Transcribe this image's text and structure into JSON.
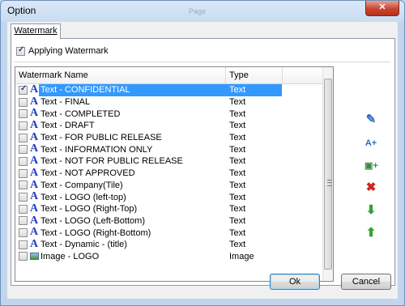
{
  "window": {
    "title": "Option",
    "ghost_title": "Page",
    "close_glyph": "✕"
  },
  "tabs": [
    {
      "label": "Watermark"
    }
  ],
  "apply": {
    "label": "Applying Watermark",
    "checked": true
  },
  "list": {
    "columns": [
      "Watermark Name",
      "Type"
    ],
    "rows": [
      {
        "name": "Text - CONFIDENTIAL",
        "type": "Text",
        "checked": true,
        "selected": true,
        "icon": "text-a-icon"
      },
      {
        "name": "Text - FINAL",
        "type": "Text",
        "checked": false,
        "icon": "text-a-icon"
      },
      {
        "name": "Text - COMPLETED",
        "type": "Text",
        "checked": false,
        "icon": "text-a-icon"
      },
      {
        "name": "Text - DRAFT",
        "type": "Text",
        "checked": false,
        "icon": "text-a-icon"
      },
      {
        "name": "Text - FOR PUBLIC RELEASE",
        "type": "Text",
        "checked": false,
        "icon": "text-a-icon"
      },
      {
        "name": "Text - INFORMATION ONLY",
        "type": "Text",
        "checked": false,
        "icon": "text-a-icon"
      },
      {
        "name": "Text - NOT FOR PUBLIC RELEASE",
        "type": "Text",
        "checked": false,
        "icon": "text-a-icon"
      },
      {
        "name": "Text - NOT APPROVED",
        "type": "Text",
        "checked": false,
        "icon": "text-a-icon"
      },
      {
        "name": "Text - Company(Tile)",
        "type": "Text",
        "checked": false,
        "icon": "text-a-icon"
      },
      {
        "name": "Text - LOGO (left-top)",
        "type": "Text",
        "checked": false,
        "icon": "text-a-icon"
      },
      {
        "name": "Text - LOGO (Right-Top)",
        "type": "Text",
        "checked": false,
        "icon": "text-a-icon"
      },
      {
        "name": "Text - LOGO (Left-Bottom)",
        "type": "Text",
        "checked": false,
        "icon": "text-a-icon"
      },
      {
        "name": "Text - LOGO (Right-Bottom)",
        "type": "Text",
        "checked": false,
        "icon": "text-a-icon"
      },
      {
        "name": "Text - Dynamic - (title)",
        "type": "Text",
        "checked": false,
        "icon": "text-a-icon"
      },
      {
        "name": "Image - LOGO",
        "type": "Image",
        "checked": false,
        "icon": "image-icon"
      }
    ]
  },
  "side_actions": [
    {
      "name": "edit-watermark-button",
      "icon": "edit-icon",
      "glyph": "✎",
      "color": "#2f6fc4"
    },
    {
      "name": "add-text-watermark-button",
      "icon": "add-text-icon",
      "glyph": "A+",
      "color": "#2f6fc4"
    },
    {
      "name": "add-image-watermark-button",
      "icon": "add-image-icon",
      "glyph": "▣+",
      "color": "#3a8a3a"
    },
    {
      "name": "delete-watermark-button",
      "icon": "delete-icon",
      "glyph": "✖",
      "color": "#d4221c"
    },
    {
      "name": "move-down-button",
      "icon": "arrow-down-icon",
      "glyph": "⬇",
      "color": "#2fa52f"
    },
    {
      "name": "move-up-button",
      "icon": "arrow-up-icon",
      "glyph": "⬆",
      "color": "#2fa52f"
    }
  ],
  "footer": {
    "ok_label": "Ok",
    "cancel_label": "Cancel"
  }
}
